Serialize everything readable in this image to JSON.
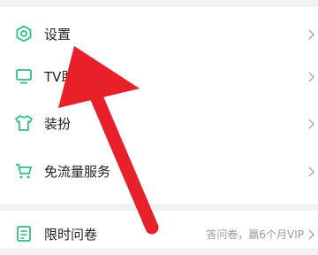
{
  "colors": {
    "accent": "#2dbf83",
    "arrow": "#e8202a",
    "chevron": "#b5b5b5"
  },
  "menu": {
    "items": [
      {
        "label": "设置",
        "icon": "hexagon-settings-icon"
      },
      {
        "label": "TV助",
        "icon": "tv-icon"
      },
      {
        "label": "装扮",
        "icon": "shirt-icon"
      },
      {
        "label": "免流量服务",
        "icon": "cart-icon"
      }
    ]
  },
  "menu2": {
    "items": [
      {
        "label": "限时问卷",
        "icon": "survey-icon",
        "extra": "答问卷，赢6个月VIP"
      }
    ]
  },
  "overlay": {
    "icon": "red-arrow-icon"
  }
}
